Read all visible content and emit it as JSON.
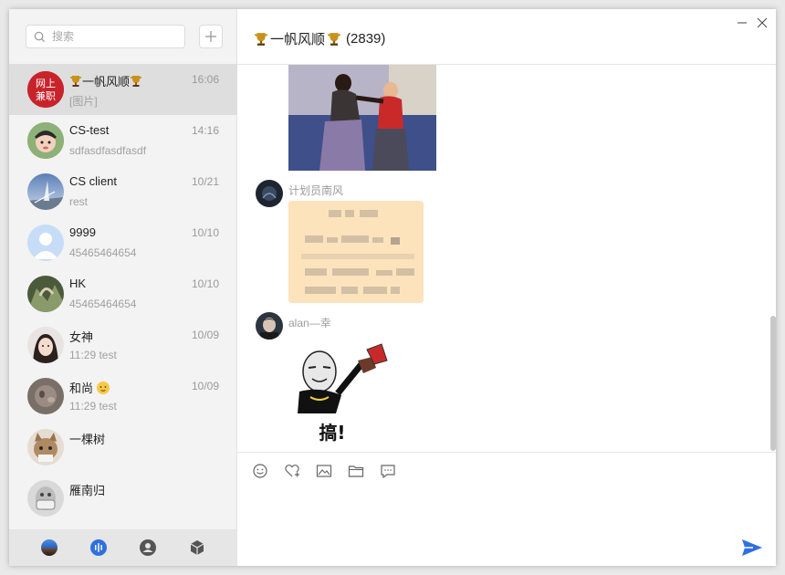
{
  "search": {
    "placeholder": "搜索"
  },
  "add_button": {
    "label": "+"
  },
  "conversations": [
    {
      "name": "一帆风顺",
      "has_trophies": true,
      "time": "16:06",
      "preview": "[图片]",
      "active": true,
      "avatar_text_top": "网上",
      "avatar_text_bottom": "兼职"
    },
    {
      "name": "CS-test",
      "time": "14:16",
      "preview": "sdfasdfasdfasdf"
    },
    {
      "name": "CS client",
      "time": "10/21",
      "preview": "rest"
    },
    {
      "name": "9999",
      "time": "10/10",
      "preview": "45465464654"
    },
    {
      "name": "HK",
      "time": "10/10",
      "preview": "45465464654"
    },
    {
      "name": "女神",
      "time": "10/09",
      "preview": "11:29 test"
    },
    {
      "name": "和尚",
      "time": "10/09",
      "preview": "11:29 test"
    },
    {
      "name": "一棵树",
      "time": "",
      "preview": ""
    },
    {
      "name": "雁南归",
      "time": "",
      "preview": ""
    }
  ],
  "chat": {
    "title": "一帆风顺",
    "member_count": "(2839)",
    "messages": [
      {
        "sender": "计划员南风",
        "type": "image"
      },
      {
        "sender": "alan—幸",
        "type": "sticker",
        "sticker_text": "搞!"
      }
    ]
  },
  "toolbar_icons": [
    "emoji-icon",
    "favorite-icon",
    "image-icon",
    "folder-icon",
    "chat-record-icon"
  ],
  "bottom_nav_icons": [
    "app-logo-icon",
    "voice-icon",
    "contacts-icon",
    "apps-cube-icon"
  ],
  "colors": {
    "accent": "#2f6fdf",
    "sidebar_bg": "#f3f3f3",
    "active_row": "#dedede",
    "bubble_bg": "#fde5c0"
  }
}
